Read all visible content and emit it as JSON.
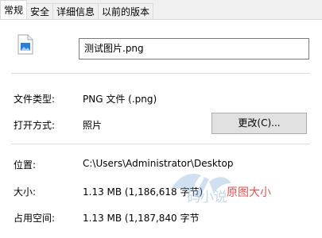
{
  "tabs": [
    {
      "label": "常规",
      "active": true
    },
    {
      "label": "安全",
      "active": false
    },
    {
      "label": "详细信息",
      "active": false
    },
    {
      "label": "以前的版本",
      "active": false
    }
  ],
  "file": {
    "name": "测试图片.png",
    "icon": "png-image-file-icon"
  },
  "properties": {
    "type_label": "文件类型:",
    "type_value": "PNG 文件 (.png)",
    "open_with_label": "打开方式:",
    "open_with_value": "照片",
    "change_button_label": "更改(C)...",
    "location_label": "位置:",
    "location_value": "C:\\Users\\Administrator\\Desktop",
    "size_label": "大小:",
    "size_value": "1.13 MB (1,186,618 字节)",
    "size_on_disk_label": "占用空间:",
    "size_on_disk_value": "1.13 MB (1,187,840 字节"
  },
  "annotation": {
    "text": "原图大小",
    "color": "#e85050"
  },
  "watermark": {
    "text": "码小说",
    "icon": "watermark-logo"
  },
  "colors": {
    "panel_background": "#ffffff",
    "window_background": "#f0f0f0",
    "icon_blue": "#2d7dd2"
  }
}
